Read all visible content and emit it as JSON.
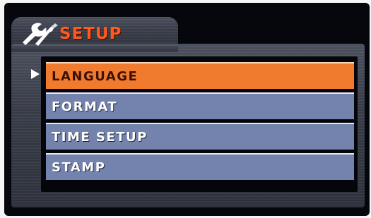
{
  "header": {
    "title": "SETUP",
    "icon": "wrench-screwdriver-icon",
    "title_color": "#ff5a1e"
  },
  "menu": {
    "selected_index": 0,
    "items": [
      {
        "label": "LANGUAGE"
      },
      {
        "label": "FORMAT"
      },
      {
        "label": "TIME SETUP"
      },
      {
        "label": "STAMP"
      }
    ],
    "selected_color": "#f07b2e",
    "item_color": "#7383ad"
  }
}
